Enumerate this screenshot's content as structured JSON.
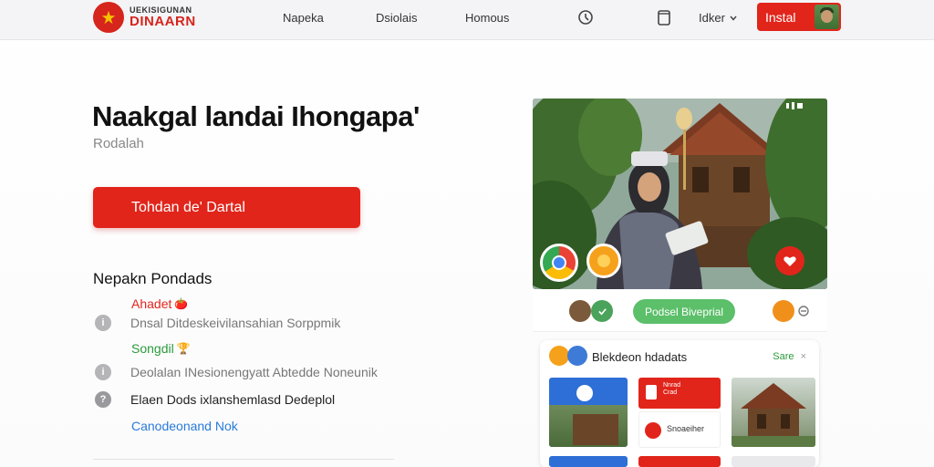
{
  "header": {
    "logo_top": "UEKISIGUNAN",
    "logo_bottom": "DINAARN",
    "nav": [
      "Napeka",
      "Dsiolais",
      "Homous"
    ],
    "language": "Idker",
    "install_label": "Instal"
  },
  "hero": {
    "title": "Naakgal landai Ihongapa'",
    "subtitle": "Rodalah",
    "cta_label": "Tohdan de' Dartal"
  },
  "features": {
    "title": "Nepakn Pondads",
    "items": [
      {
        "kind": "tag-red",
        "text": "Ahadet",
        "emoji": "🍅"
      },
      {
        "kind": "info",
        "icon": "i",
        "text": "Dnsal Ditdeskeivilansahian Sorppmik"
      },
      {
        "kind": "tag-green",
        "text": "Songdil",
        "emoji": "🏆"
      },
      {
        "kind": "info",
        "icon": "i",
        "text": "Deolalan INesionengyatt Abtedde Noneunik"
      },
      {
        "kind": "strong",
        "icon": "?",
        "text": "Elaen Dods ixlanshemlasd Dedeplol"
      },
      {
        "kind": "link",
        "text": "Canodeonand Nok"
      }
    ]
  },
  "phone": {
    "pill_label": "Podsel Biveprial",
    "card_title": "Blekdeon hdadats",
    "card_action": "Sare",
    "card_close": "×",
    "tile_red_top_line1": "Nnrad",
    "tile_red_top_line2": "Crad",
    "tile_label": "Snoaeiher"
  },
  "colors": {
    "accent_red": "#e1251b",
    "green": "#5cbf6a",
    "link_blue": "#2a7ad8"
  }
}
